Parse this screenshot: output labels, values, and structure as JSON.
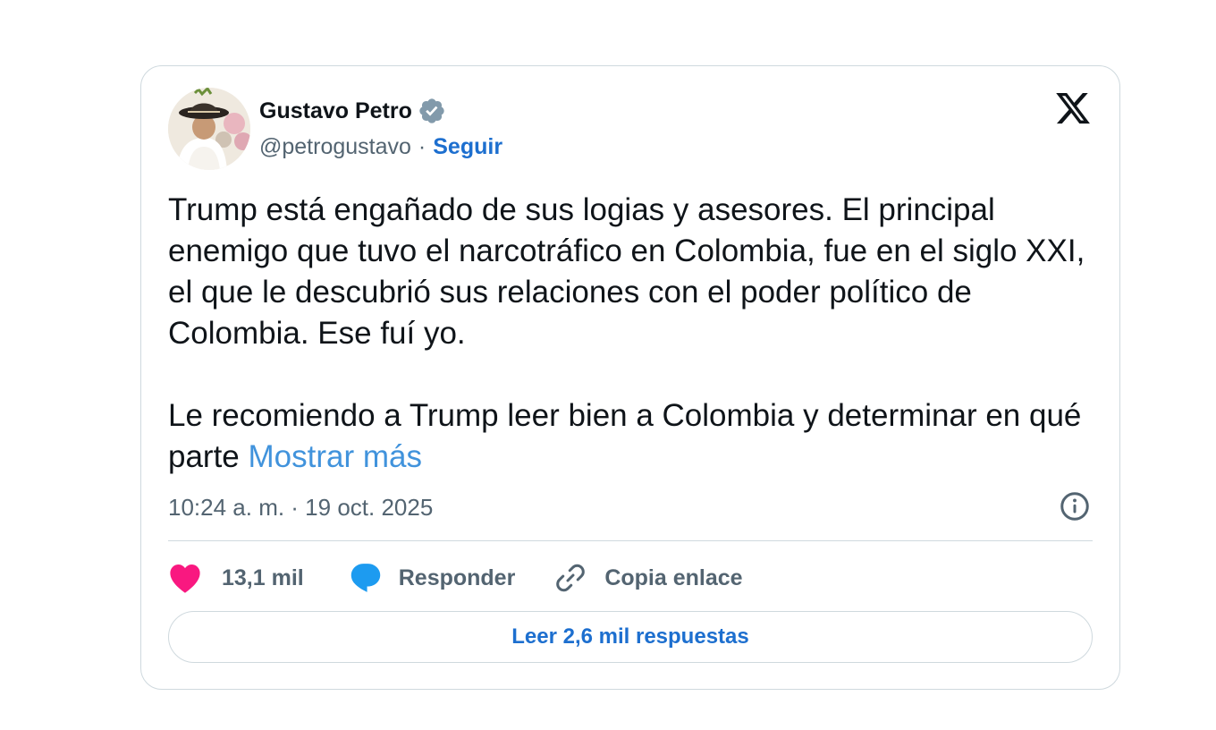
{
  "author": {
    "name": "Gustavo Petro",
    "handle": "@petrogustavo",
    "separator": "·",
    "follow_label": "Seguir",
    "verified_icon": "verified-badge-icon",
    "verified_color": "#829aab"
  },
  "platform_icon": "x-logo-icon",
  "tweet": {
    "text": "Trump está engañado de sus logias y asesores. El principal enemigo que tuvo el narcotráfico en Colombia, fue en el siglo XXI, el que le descubrió sus relaciones con el poder político de Colombia. Ese fuí yo.\n\nLe recomiendo a Trump leer bien a Colombia y determinar en qué parte ",
    "show_more_label": "Mostrar más"
  },
  "meta": {
    "timestamp": "10:24 a. m. · 19 oct. 2025",
    "info_icon": "info-icon"
  },
  "actions": {
    "like_count": "13,1 mil",
    "like_icon": "heart-icon",
    "like_color": "#f91880",
    "reply_label": "Responder",
    "reply_icon": "speech-bubble-icon",
    "reply_color": "#1d9bf0",
    "copy_label": "Copia enlace",
    "copy_icon": "link-icon"
  },
  "read_replies_label": "Leer 2,6 mil respuestas",
  "colors": {
    "link_blue": "#1d6fcf",
    "show_more_blue": "#4193dc",
    "text_primary": "#0f1419",
    "text_secondary": "#536471",
    "border": "#cfd9de"
  }
}
